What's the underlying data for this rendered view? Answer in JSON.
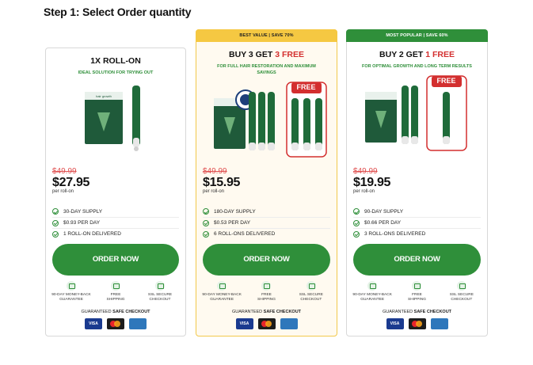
{
  "step_title": "Step 1: Select Order quantity",
  "colors": {
    "accent_green": "#2f8f3a",
    "free_red": "#d32f2f",
    "gold_ribbon": "#f5c842",
    "old_price_red": "#e05252"
  },
  "cards": [
    {
      "ribbon": "",
      "headline_main": "1X ROLL-ON",
      "headline_free": "",
      "subline": "IDEAL SOLUTION FOR TRYING OUT",
      "free_label": "",
      "old_price": "$49.99",
      "price": "$27.95",
      "per": "per roll-on",
      "features": [
        "30-DAY SUPPLY",
        "$0.93 PER DAY",
        "1 ROLL-ON DELIVERED"
      ],
      "button": "ORDER NOW"
    },
    {
      "ribbon": "BEST VALUE | SAVE 70%",
      "headline_main": "BUY 3 GET ",
      "headline_free": "3 FREE",
      "subline": "FOR FULL HAIR RESTORATION AND MAXIMUM SAVINGS",
      "free_label": "FREE",
      "old_price": "$49.99",
      "price": "$15.95",
      "per": "per roll-on",
      "features": [
        "180-DAY SUPPLY",
        "$0.53 PER DAY",
        "6 ROLL-ONS DELIVERED"
      ],
      "button": "ORDER NOW"
    },
    {
      "ribbon": "MOST POPULAR | SAVE 60%",
      "headline_main": "BUY 2 GET ",
      "headline_free": "1 FREE",
      "subline": "FOR OPTIMAL GROWTH AND LONG TERM RESULTS",
      "free_label": "FREE",
      "old_price": "$49.99",
      "price": "$19.95",
      "per": "per roll-on",
      "features": [
        "90-DAY SUPPLY",
        "$0.66 PER DAY",
        "3 ROLL-ONS DELIVERED"
      ],
      "button": "ORDER NOW"
    }
  ],
  "badges": [
    {
      "icon": "money-back-icon",
      "line1": "90-DAY MONEY-BACK",
      "line2": "GUARANTEE"
    },
    {
      "icon": "truck-icon",
      "line1": "FREE",
      "line2": "SHIPPING"
    },
    {
      "icon": "lock-icon",
      "line1": "SSL SECURE",
      "line2": "CHECKOUT"
    }
  ],
  "secure": {
    "prefix": "GUARANTEED ",
    "bold": "SAFE CHECKOUT"
  },
  "payments": {
    "visa": "VISA",
    "amex": "AMERICAN EXPRESS"
  }
}
